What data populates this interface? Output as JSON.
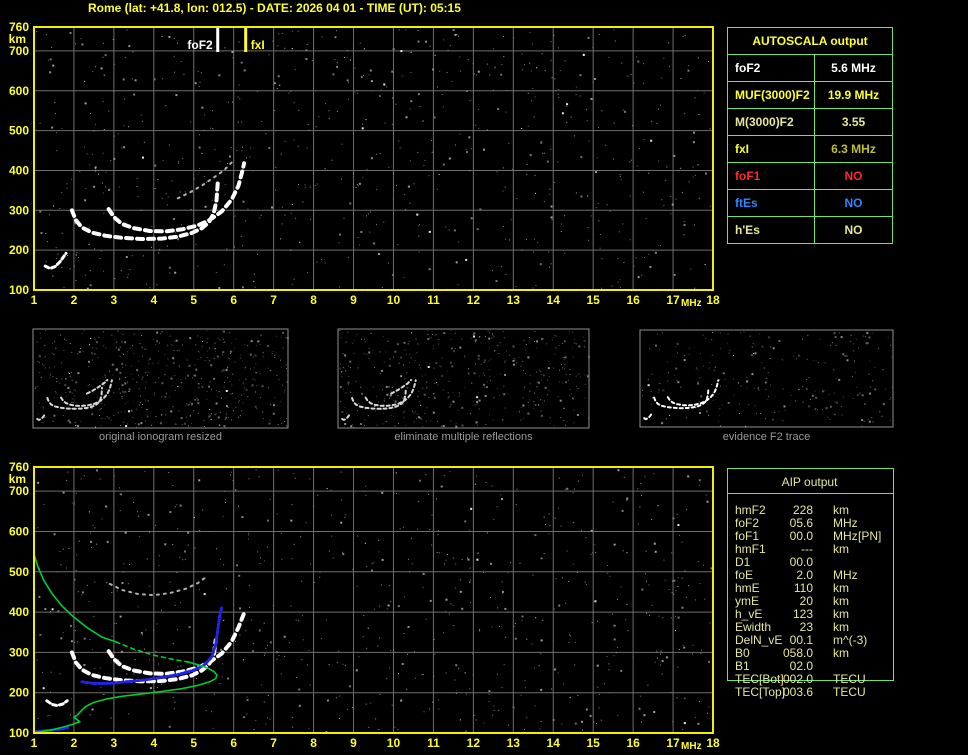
{
  "title": "Rome (lat: +41.8, lon: 012.5) - DATE: 2026 04 01 - TIME (UT): 05:15",
  "colors": {
    "accent_yellow": "#ffff29",
    "border_yellow": "#f0f000",
    "grid_gray": "#6e6e6e",
    "table_green": "#6fe26f",
    "khaki": "#e6e69a",
    "trace_white": "#ffffff",
    "profile_green": "#00cc33",
    "restored_blue": "#2222ee",
    "caption_gray": "#9a9a9a",
    "status_red": "#ff2a2a",
    "status_blue": "#2e86ff",
    "olive_value": "#bebe32"
  },
  "autoscala_table": {
    "header": "AUTOSCALA output",
    "rows": [
      {
        "label": "foF2",
        "value": "5.6 MHz",
        "label_color": "#ffffff",
        "value_color": "#ffffff"
      },
      {
        "label": "MUF(3000)F2",
        "value": "19.9 MHz",
        "label_color": "#ffff29",
        "value_color": "#ffff29"
      },
      {
        "label": "M(3000)F2",
        "value": "3.55",
        "label_color": "#e6e69a",
        "value_color": "#e6e69a"
      },
      {
        "label": "fxI",
        "value": "6.3 MHz",
        "label_color": "#ffff29",
        "value_color": "#bebe32"
      },
      {
        "label": "foF1",
        "value": "NO",
        "label_color": "#ff2a2a",
        "value_color": "#ff2a2a"
      },
      {
        "label": "ftEs",
        "value": "NO",
        "label_color": "#2e86ff",
        "value_color": "#2e86ff"
      },
      {
        "label": "h'Es",
        "value": "NO",
        "label_color": "#e6e69a",
        "value_color": "#e6e69a"
      }
    ]
  },
  "aip_table": {
    "header": "AIP output",
    "rows": [
      {
        "label": "hmF2",
        "value": "228",
        "unit": "km",
        "note": ""
      },
      {
        "label": "foF2",
        "value": "05.6",
        "unit": "MHz",
        "note": ""
      },
      {
        "label": "foF1",
        "value": "00.0",
        "unit": "MHz",
        "note": "[PN]"
      },
      {
        "label": "hmF1",
        "value": "---",
        "unit": "km",
        "note": ""
      },
      {
        "label": "D1",
        "value": "00.0",
        "unit": "",
        "note": ""
      },
      {
        "label": "foE",
        "value": "2.0",
        "unit": "MHz",
        "note": ""
      },
      {
        "label": "hmE",
        "value": "110",
        "unit": "km",
        "note": ""
      },
      {
        "label": "ymE",
        "value": "20",
        "unit": "km",
        "note": ""
      },
      {
        "label": "h_vE",
        "value": "123",
        "unit": "km",
        "note": ""
      },
      {
        "label": "Ewidth",
        "value": "23",
        "unit": "km",
        "note": ""
      },
      {
        "label": "DelN_vE",
        "value": "00.1",
        "unit": "m^(-3)",
        "note": ""
      },
      {
        "label": "B0",
        "value": "058.0",
        "unit": "km",
        "note": ""
      },
      {
        "label": "B1",
        "value": "02.0",
        "unit": "",
        "note": ""
      },
      {
        "label": "TEC[Bot]",
        "value": "002.0",
        "unit": "TECU",
        "note": ""
      },
      {
        "label": "TEC[Top]",
        "value": "003.6",
        "unit": "TECU",
        "note": ""
      }
    ]
  },
  "thumbnails": [
    {
      "caption": "original ionogram resized"
    },
    {
      "caption": "eliminate multiple reflections"
    },
    {
      "caption": "evidence F2 trace"
    }
  ],
  "axis": {
    "x_ticks": [
      "1",
      "2",
      "3",
      "4",
      "5",
      "6",
      "7",
      "8",
      "9",
      "10",
      "11",
      "12",
      "13",
      "14",
      "15",
      "16",
      "17",
      "18"
    ],
    "x_unit": "MHz",
    "y_ticks": [
      "760",
      "700",
      "600",
      "500",
      "400",
      "300",
      "200",
      "100"
    ],
    "y_unit": "km"
  },
  "chart_data": [
    {
      "id": "ionogram-top",
      "type": "scatter",
      "title": "recorded ionogram with autoscaled characteristics",
      "xlabel": "MHz",
      "ylabel": "km",
      "xlim": [
        1,
        18
      ],
      "ylim": [
        100,
        760
      ],
      "grid": true,
      "annotations": [
        {
          "label": "foF2",
          "x": 5.6,
          "color": "#ffffff"
        },
        {
          "label": "fxI",
          "x": 6.3,
          "color": "#ffff29"
        }
      ],
      "series": [
        {
          "name": "F2-trace-O-mode",
          "color": "#ffffff",
          "role": "trace",
          "points": [
            [
              1.95,
              300
            ],
            [
              2.05,
              275
            ],
            [
              2.2,
              257
            ],
            [
              2.45,
              244
            ],
            [
              2.8,
              236
            ],
            [
              3.2,
              231
            ],
            [
              3.7,
              228
            ],
            [
              4.2,
              229
            ],
            [
              4.6,
              234
            ],
            [
              4.95,
              243
            ],
            [
              5.2,
              255
            ],
            [
              5.38,
              270
            ],
            [
              5.5,
              292
            ],
            [
              5.57,
              325
            ],
            [
              5.6,
              368
            ]
          ]
        },
        {
          "name": "F2-trace-X-mode",
          "color": "#ffffff",
          "role": "trace",
          "points": [
            [
              2.87,
              303
            ],
            [
              3.0,
              283
            ],
            [
              3.2,
              266
            ],
            [
              3.5,
              255
            ],
            [
              3.9,
              248
            ],
            [
              4.3,
              247
            ],
            [
              4.7,
              252
            ],
            [
              5.1,
              262
            ],
            [
              5.4,
              276
            ],
            [
              5.7,
              297
            ],
            [
              5.95,
              327
            ],
            [
              6.12,
              362
            ],
            [
              6.22,
              400
            ],
            [
              6.26,
              418
            ]
          ]
        },
        {
          "name": "low-echo-hook",
          "color": "#ffffff",
          "role": "trace-thin",
          "points": [
            [
              1.28,
              160
            ],
            [
              1.4,
              154
            ],
            [
              1.53,
              159
            ],
            [
              1.66,
              172
            ],
            [
              1.8,
              192
            ]
          ]
        },
        {
          "name": "second-hop-echo",
          "color": "#b0b0b0",
          "role": "dots",
          "points": [
            [
              4.6,
              330
            ],
            [
              4.9,
              345
            ],
            [
              5.2,
              362
            ],
            [
              5.5,
              382
            ],
            [
              5.75,
              400
            ],
            [
              5.95,
              420
            ]
          ]
        }
      ]
    },
    {
      "id": "ionogram-bottom",
      "type": "scatter",
      "title": "ionogram with restored trace and electron density profile",
      "xlabel": "MHz",
      "ylabel": "km",
      "xlim": [
        1,
        18
      ],
      "ylim": [
        100,
        760
      ],
      "grid": true,
      "annotations": [],
      "series": [
        {
          "name": "F2-trace-O-mode",
          "color": "#ffffff",
          "role": "trace",
          "points": [
            [
              1.95,
              300
            ],
            [
              2.05,
              275
            ],
            [
              2.2,
              257
            ],
            [
              2.45,
              244
            ],
            [
              2.8,
              236
            ],
            [
              3.2,
              231
            ],
            [
              3.7,
              228
            ],
            [
              4.2,
              229
            ],
            [
              4.6,
              234
            ],
            [
              4.95,
              243
            ],
            [
              5.2,
              255
            ],
            [
              5.38,
              270
            ],
            [
              5.5,
              292
            ],
            [
              5.55,
              330
            ]
          ]
        },
        {
          "name": "F2-trace-X-mode",
          "color": "#ffffff",
          "role": "trace",
          "points": [
            [
              2.87,
              303
            ],
            [
              3.0,
              283
            ],
            [
              3.2,
              266
            ],
            [
              3.5,
              255
            ],
            [
              3.9,
              248
            ],
            [
              4.3,
              247
            ],
            [
              4.7,
              252
            ],
            [
              5.1,
              262
            ],
            [
              5.4,
              276
            ],
            [
              5.7,
              297
            ],
            [
              5.95,
              327
            ],
            [
              6.12,
              362
            ],
            [
              6.25,
              395
            ]
          ]
        },
        {
          "name": "low-echo-hook",
          "color": "#ffffff",
          "role": "trace-thin",
          "points": [
            [
              1.32,
              180
            ],
            [
              1.45,
              171
            ],
            [
              1.58,
              168
            ],
            [
              1.72,
              172
            ],
            [
              1.83,
              180
            ]
          ]
        },
        {
          "name": "second-hop-echo",
          "color": "#b0b0b0",
          "role": "dots",
          "points": [
            [
              2.9,
              470
            ],
            [
              3.2,
              455
            ],
            [
              3.6,
              445
            ],
            [
              4.0,
              442
            ],
            [
              4.4,
              447
            ],
            [
              4.8,
              458
            ],
            [
              5.1,
              472
            ],
            [
              5.35,
              490
            ]
          ]
        },
        {
          "name": "restored-F2-trace",
          "color": "#2222ee",
          "role": "blue",
          "points": [
            [
              2.2,
              227
            ],
            [
              2.5,
              223
            ],
            [
              2.9,
              223
            ],
            [
              3.3,
              227
            ],
            [
              3.8,
              232
            ],
            [
              4.2,
              238
            ],
            [
              4.6,
              245
            ],
            [
              5.0,
              256
            ],
            [
              5.25,
              268
            ],
            [
              5.45,
              288
            ],
            [
              5.55,
              320
            ],
            [
              5.6,
              355
            ],
            [
              5.65,
              390
            ],
            [
              5.7,
              412
            ]
          ]
        },
        {
          "name": "restored-E-trace",
          "color": "#2222ee",
          "role": "blue",
          "points": [
            [
              1.0,
              104
            ],
            [
              1.2,
              105
            ],
            [
              1.45,
              107
            ],
            [
              1.7,
              110
            ],
            [
              1.85,
              114
            ]
          ]
        },
        {
          "name": "electron-density-profile-top",
          "color": "#00cc33",
          "role": "profile",
          "points": [
            [
              1.0,
              543
            ],
            [
              1.1,
              512
            ],
            [
              1.25,
              478
            ],
            [
              1.45,
              446
            ],
            [
              1.7,
              415
            ],
            [
              2.0,
              387
            ],
            [
              2.35,
              360
            ],
            [
              2.7,
              338
            ],
            [
              3.05,
              326
            ]
          ]
        },
        {
          "name": "electron-density-profile-valley",
          "color": "#00cc33",
          "role": "profile-dash",
          "points": [
            [
              3.05,
              326
            ],
            [
              3.5,
              308
            ],
            [
              4.0,
              293
            ],
            [
              4.45,
              283
            ],
            [
              4.87,
              276
            ]
          ]
        },
        {
          "name": "electron-density-profile-bottom",
          "color": "#00cc33",
          "role": "profile",
          "points": [
            [
              4.87,
              276
            ],
            [
              5.15,
              268
            ],
            [
              5.35,
              261
            ],
            [
              5.5,
              253
            ],
            [
              5.58,
              244
            ],
            [
              5.55,
              235
            ],
            [
              5.4,
              227
            ],
            [
              5.1,
              218
            ],
            [
              4.7,
              210
            ],
            [
              4.2,
              203
            ],
            [
              3.7,
              197
            ],
            [
              3.2,
              191
            ],
            [
              2.8,
              184
            ],
            [
              2.5,
              176
            ],
            [
              2.3,
              166
            ],
            [
              2.18,
              155
            ],
            [
              2.1,
              146
            ],
            [
              2.0,
              139
            ],
            [
              2.08,
              133
            ],
            [
              2.15,
              128
            ],
            [
              1.95,
              121
            ],
            [
              1.7,
              114
            ],
            [
              1.45,
              108
            ],
            [
              1.2,
              104
            ],
            [
              1.02,
              101
            ]
          ]
        }
      ]
    }
  ]
}
